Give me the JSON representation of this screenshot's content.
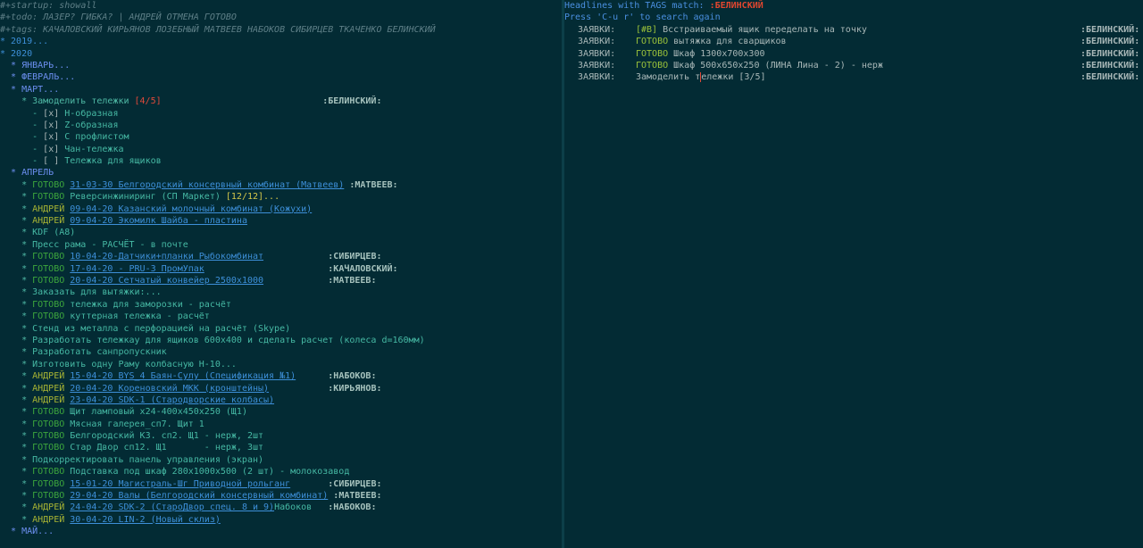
{
  "left": {
    "meta": [
      {
        "kw": "#+startup:",
        "val": " showall"
      },
      {
        "kw": "#+todo:",
        "val": " ЛАЗЕР? ГИБКА? | АНДРЕЙ ОТМЕНА ГОТОВО"
      },
      {
        "kw": "#+tags:",
        "val": " КАЧАЛОВСКИЙ КИРЬЯНОВ ЛОЗЕБНЫЙ МАТВЕЕВ НАБОКОВ СИБИРЦЕВ ТКАЧЕНКО БЕЛИНСКИЙ"
      }
    ],
    "h2019": "* 2019...",
    "h2020": "* 2020",
    "jan": "  * ЯНВАРЬ...",
    "feb": "  * ФЕВРАЛЬ...",
    "mar": "  * МАРТ...",
    "mar_item": {
      "prefix": "    * ",
      "title": "Замоделить тележки ",
      "progress": "[4/5]",
      "tag": ":БЕЛИНСКИЙ:"
    },
    "checklist": [
      {
        "box": "[x]",
        "label": "Н-образная"
      },
      {
        "box": "[x]",
        "label": "Z-образная"
      },
      {
        "box": "[x]",
        "label": "С профлистом"
      },
      {
        "box": "[x]",
        "label": "Чан-тележка"
      },
      {
        "box": "[ ]",
        "label": "Тележка для ящиков"
      }
    ],
    "apr": "  * АПРЕЛЬ",
    "apr_items": [
      {
        "kw": "ГОТОВО",
        "link": "31-03-30 Белгородский консервный комбинат (Матвеев)",
        "text": "",
        "prog": "",
        "tag": ":МАТВЕЕВ:"
      },
      {
        "kw": "ГОТОВО",
        "link": "",
        "text": "Реверсинжиниринг (СП Маркет) ",
        "prog": "[12/12]...",
        "tag": ""
      },
      {
        "kw": "АНДРЕЙ",
        "link": "09-04-20 Казанский молочный комбинат (Кожухи)",
        "text": "",
        "prog": "",
        "tag": ""
      },
      {
        "kw": "АНДРЕЙ",
        "link": "09-04-20 Экомилк Шайба - пластина",
        "text": "",
        "prog": "",
        "tag": ""
      },
      {
        "kw": "",
        "link": "",
        "text": "KDF (A8)",
        "prog": "",
        "tag": ""
      },
      {
        "kw": "",
        "link": "",
        "text": "Пресс рама - РАСЧЁТ - в почте",
        "prog": "",
        "tag": ""
      },
      {
        "kw": "ГОТОВО",
        "link": "10-04-20-Датчики+планки Рыбокомбинат",
        "text": "",
        "prog": "",
        "tag": ":СИБИРЦЕВ:"
      },
      {
        "kw": "ГОТОВО",
        "link": "17-04-20 - PRU-3 ПромУпак",
        "text": "",
        "prog": "",
        "tag": ":КАЧАЛОВСКИЙ:"
      },
      {
        "kw": "ГОТОВО",
        "link": "20-04-20 Сетчатый конвейер 2500x1000",
        "text": "",
        "prog": "",
        "tag": ":МАТВЕЕВ:"
      },
      {
        "kw": "",
        "link": "",
        "text": "Заказать для вытяжки:...",
        "prog": "",
        "tag": ""
      },
      {
        "kw": "ГОТОВО",
        "link": "",
        "text": "тележка для заморозки - расчёт",
        "prog": "",
        "tag": ""
      },
      {
        "kw": "ГОТОВО",
        "link": "",
        "text": "куттерная тележка - расчёт",
        "prog": "",
        "tag": ""
      },
      {
        "kw": "",
        "link": "",
        "text": "Стенд из металла с перфорацией на расчёт (Skype)",
        "prog": "",
        "tag": ""
      },
      {
        "kw": "",
        "link": "",
        "text": "Разработать тележкау для ящиков 600x400 и сделать расчет (колеса d=160мм)",
        "prog": "",
        "tag": ""
      },
      {
        "kw": "",
        "link": "",
        "text": "Разработать санпропускник",
        "prog": "",
        "tag": ""
      },
      {
        "kw": "",
        "link": "",
        "text": "Изготовить одну Раму колбасную Н-10...",
        "prog": "",
        "tag": ""
      },
      {
        "kw": "АНДРЕЙ",
        "link": "15-04-20 BYS_4 Баян-Сулу (Спецификация №1)",
        "text": "",
        "prog": "",
        "tag": ":НАБОКОВ:"
      },
      {
        "kw": "АНДРЕЙ",
        "link": "20-04-20 Кореновский МКК (кронштейны)",
        "text": "",
        "prog": "",
        "tag": ":КИРЬЯНОВ:"
      },
      {
        "kw": "АНДРЕЙ",
        "link": "23-04-20 SDK-1 (Стародворские колбасы)",
        "text": "",
        "prog": "",
        "tag": ""
      },
      {
        "kw": "ГОТОВО",
        "link": "",
        "text": "Щит ламповый x24-400x450x250 (Щ1)",
        "prog": "",
        "tag": ""
      },
      {
        "kw": "ГОТОВО",
        "link": "",
        "text": "Мясная галерея_сп7. Щит 1",
        "prog": "",
        "tag": ""
      },
      {
        "kw": "ГОТОВО",
        "link": "",
        "text": "Белгородский КЗ. сп2. Щ1 - нерж, 2шт",
        "prog": "",
        "tag": ""
      },
      {
        "kw": "ГОТОВО",
        "link": "",
        "text": "Стар Двор сп12. Щ1       - нерж, 3шт",
        "prog": "",
        "tag": ""
      },
      {
        "kw": "",
        "link": "",
        "text": "Подкорректировать панель управления (экран)",
        "prog": "",
        "tag": ""
      },
      {
        "kw": "ГОТОВО",
        "link": "",
        "text": "Подставка под шкаф 280x1000x500 (2 шт) - молокозавод",
        "prog": "",
        "tag": ""
      },
      {
        "kw": "ГОТОВО",
        "link": "15-01-20 Магистраль-Шг Приводной рольганг",
        "text": "",
        "prog": "",
        "tag": ":СИБИРЦЕВ:"
      },
      {
        "kw": "ГОТОВО",
        "link": "29-04-20 Валы (Белгородский консервный комбинат)",
        "text": "",
        "prog": "",
        "tag": ":МАТВЕЕВ:"
      },
      {
        "kw": "АНДРЕЙ",
        "link": "24-04-20 SDK-2 (СтароДвор спец. 8 и 9)",
        "text": "Набоков",
        "prog": "",
        "tag": ":НАБОКОВ:"
      },
      {
        "kw": "АНДРЕЙ",
        "link": "30-04-20 LIN-2 (Новый склиз)",
        "text": "",
        "prog": "",
        "tag": ""
      }
    ],
    "may": "  * МАЙ..."
  },
  "right": {
    "header_prefix": "Headlines with TAGS match: ",
    "header_tag": ":БЕЛИНСКИЙ",
    "hint": "Press 'C-u r' to search again",
    "rows": [
      {
        "cat": "ЗАЯВКИ:",
        "kw": "",
        "prio": "[#B]",
        "text": " Всстраиваемый ящик переделать на точку",
        "tag": ":БЕЛИНСКИЙ:"
      },
      {
        "cat": "ЗАЯВКИ:",
        "kw": "ГОТОВО",
        "prio": "",
        "text": " вытяжка для сварщиков",
        "tag": ":БЕЛИНСКИЙ:"
      },
      {
        "cat": "ЗАЯВКИ:",
        "kw": "ГОТОВО",
        "prio": "",
        "text": " Шкаф 1300x700x300",
        "tag": ":БЕЛИНСКИЙ:"
      },
      {
        "cat": "ЗАЯВКИ:",
        "kw": "ГОТОВО",
        "prio": "",
        "text": " Шкаф 500x650x250 (ЛИНА Лина - 2) - нерж",
        "tag": ":БЕЛИНСКИЙ:"
      },
      {
        "cat": "ЗАЯВКИ:",
        "kw": "",
        "prio": "",
        "text": "Замоделить тележки [3/5]",
        "tag": ":БЕЛИНСКИЙ:"
      }
    ]
  },
  "colors": {
    "background": "#032b34",
    "keyword_done": "#3da73d",
    "keyword_person": "#a8b433",
    "link": "#3d8fd8",
    "tag_highlight": "#e2462f"
  }
}
